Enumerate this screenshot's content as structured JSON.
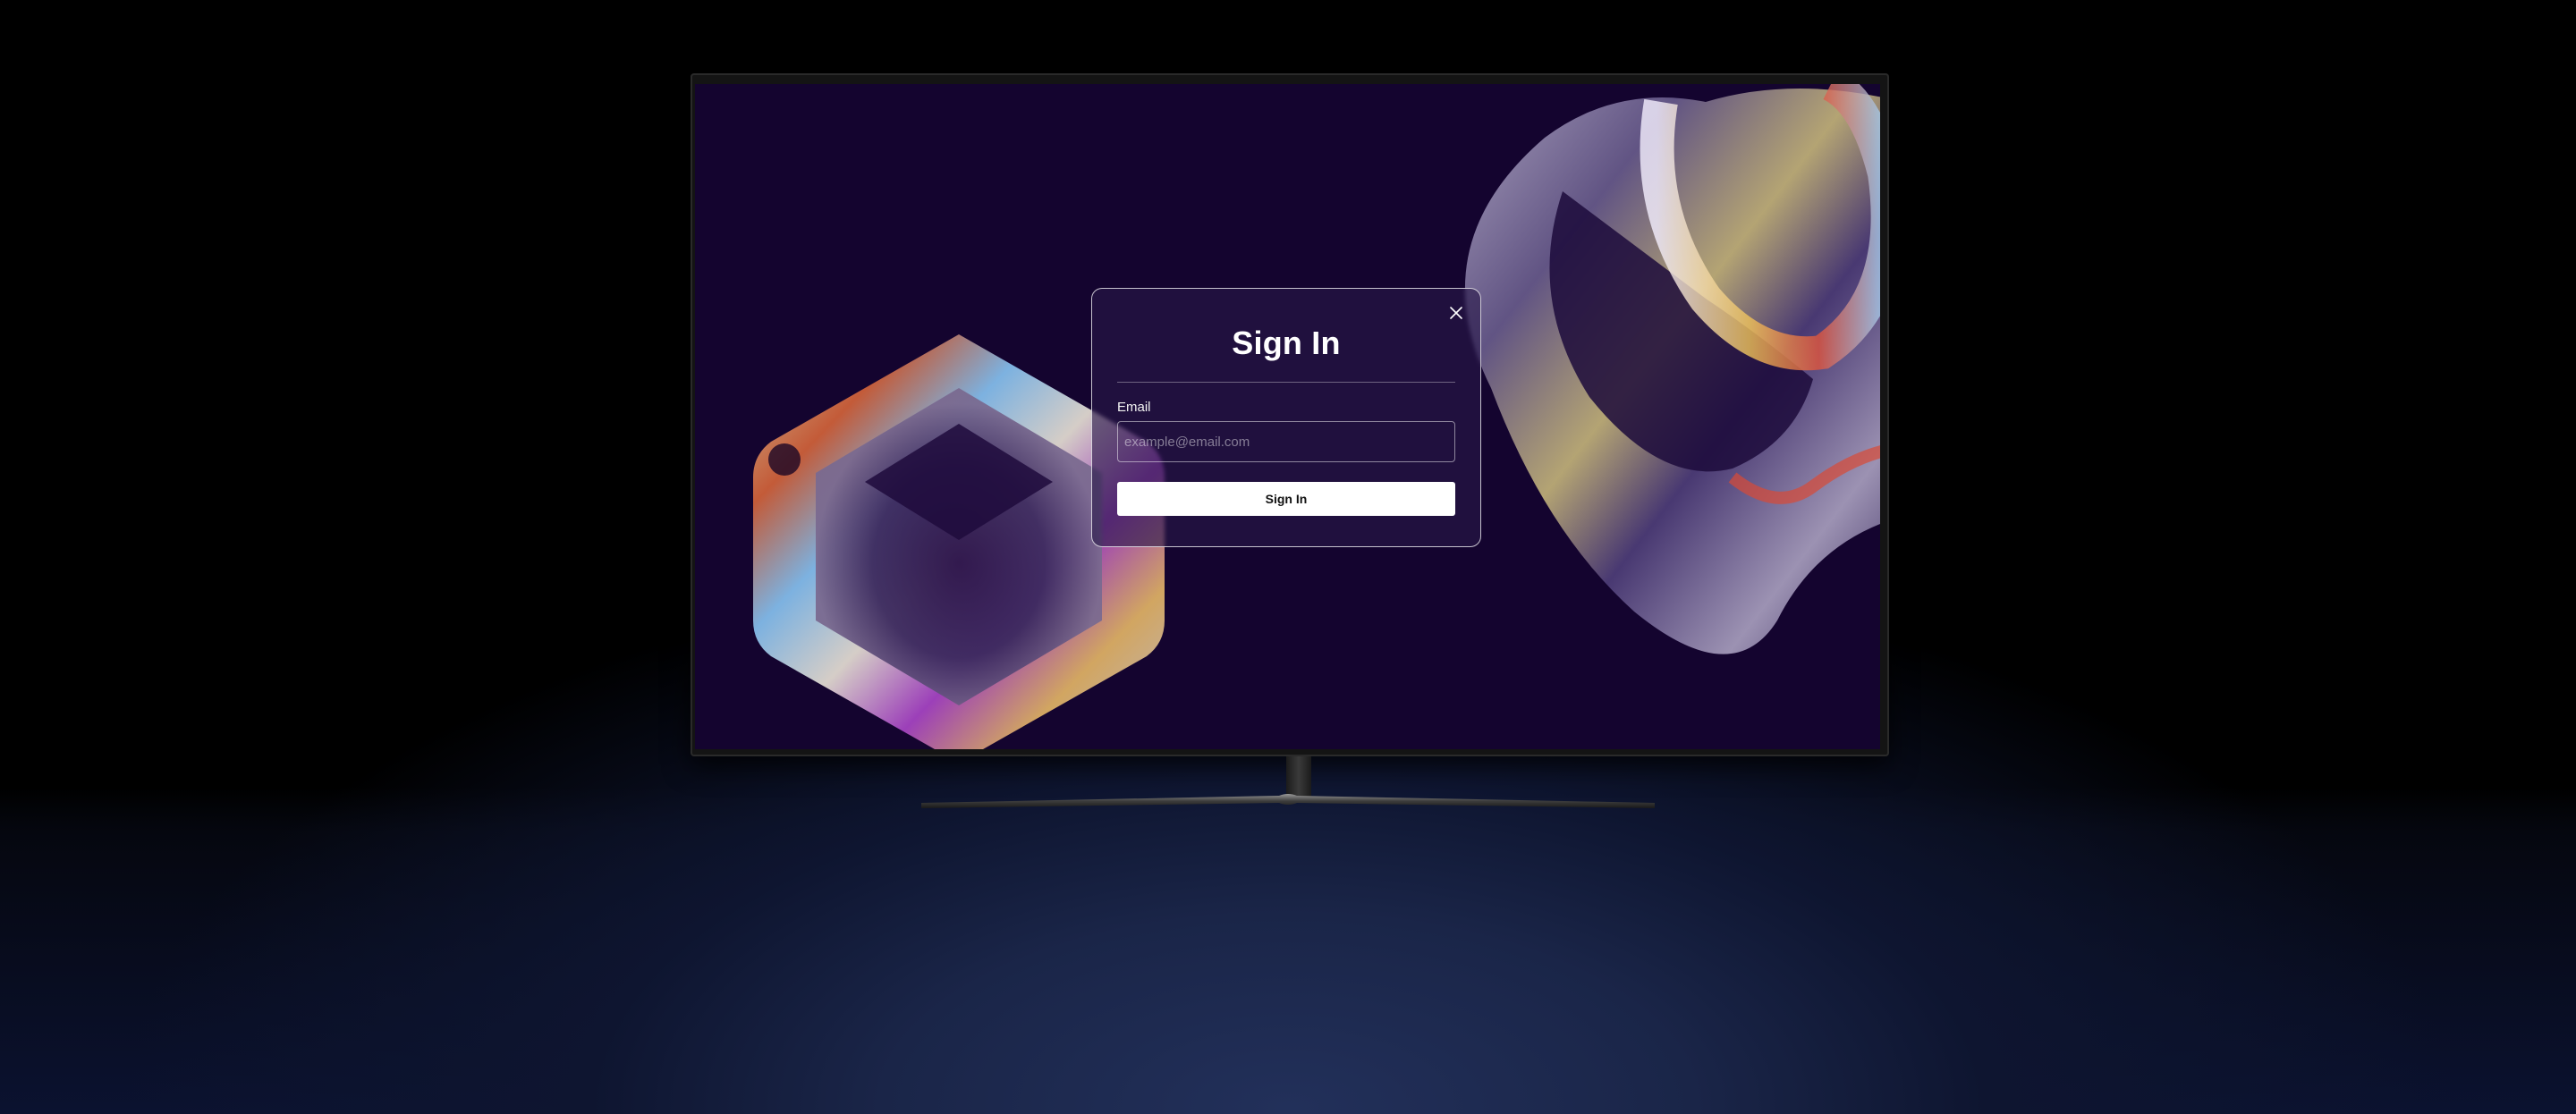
{
  "modal": {
    "title": "Sign In",
    "email_label": "Email",
    "email_placeholder": "example@email.com",
    "email_value": "",
    "submit_label": "Sign In",
    "close_icon": "close-icon"
  },
  "colors": {
    "screen_background": "#14042f",
    "modal_border": "#ffffff",
    "button_background": "#ffffff",
    "button_text": "#111111"
  }
}
